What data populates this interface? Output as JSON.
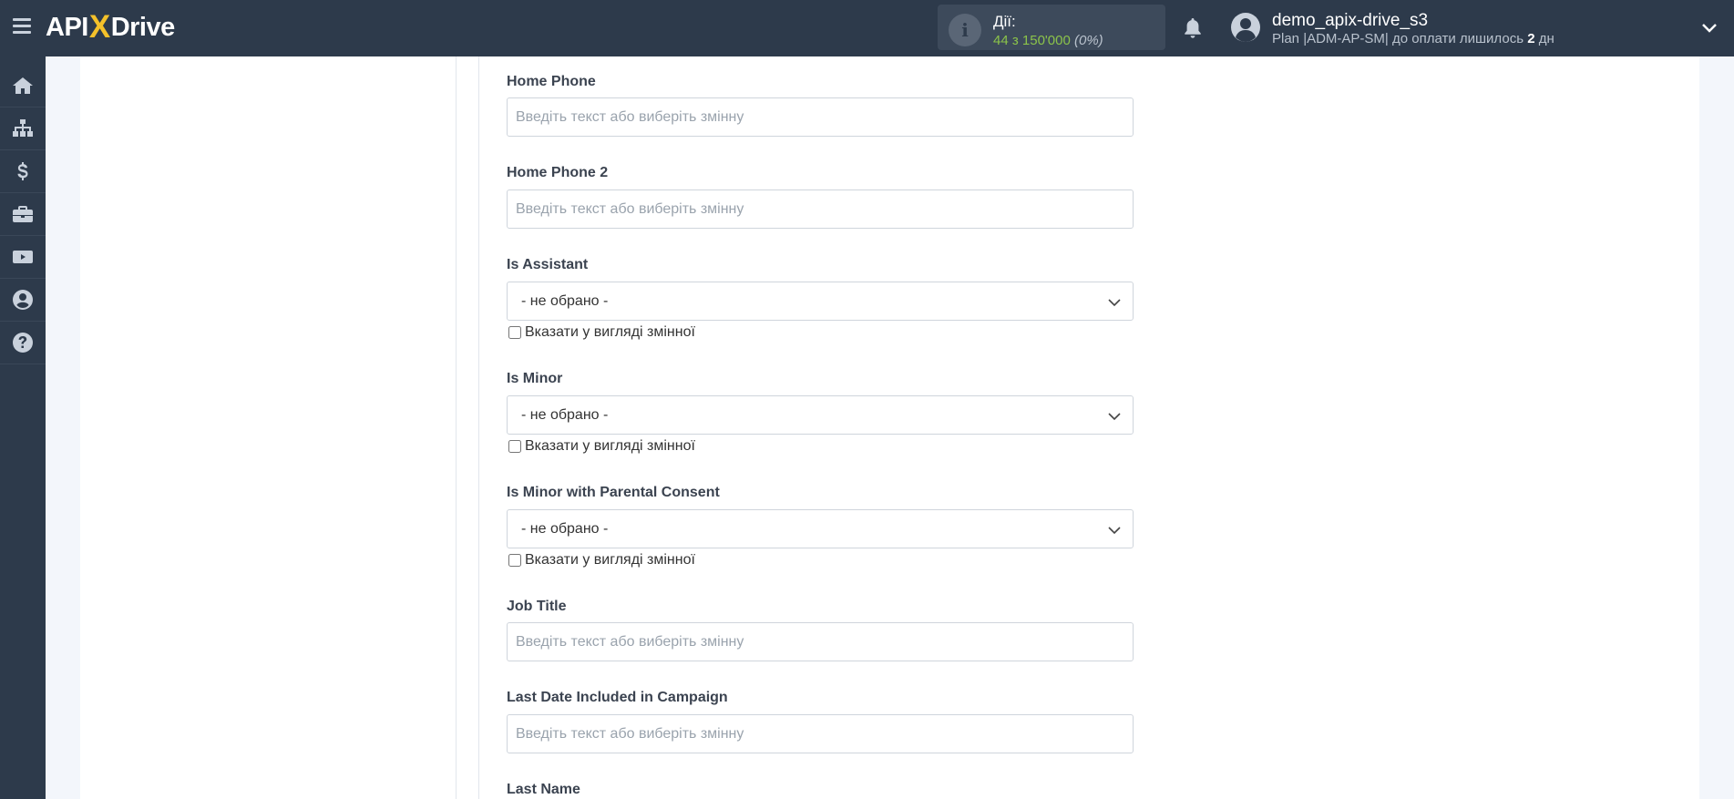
{
  "header": {
    "logo_left": "API",
    "logo_x": "X",
    "logo_right": "Drive",
    "actions_label": "Дії:",
    "actions_count": "44 з 150'000",
    "actions_percent": "(0%)",
    "user_name": "demo_apix-drive_s3",
    "user_plan_prefix": "Plan |ADM-AP-SM| до оплати лишилось",
    "user_plan_days": "2",
    "user_plan_suffix": "дн"
  },
  "sidebar": {
    "items": [
      {
        "icon": "home-icon"
      },
      {
        "icon": "sitemap-icon"
      },
      {
        "icon": "dollar-icon"
      },
      {
        "icon": "briefcase-icon"
      },
      {
        "icon": "youtube-icon"
      },
      {
        "icon": "user-circle-icon"
      },
      {
        "icon": "help-icon"
      }
    ]
  },
  "form": {
    "home_phone": {
      "label": "Home Phone",
      "placeholder": "Введіть текст або виберіть змінну",
      "value": ""
    },
    "home_phone_2": {
      "label": "Home Phone 2",
      "placeholder": "Введіть текст або виберіть змінну",
      "value": ""
    },
    "is_assistant": {
      "label": "Is Assistant",
      "selected": "- не обрано -",
      "checkbox_label": "Вказати у вигляді змінної"
    },
    "is_minor": {
      "label": "Is Minor",
      "selected": "- не обрано -",
      "checkbox_label": "Вказати у вигляді змінної"
    },
    "is_minor_parental": {
      "label": "Is Minor with Parental Consent",
      "selected": "- не обрано -",
      "checkbox_label": "Вказати у вигляді змінної"
    },
    "job_title": {
      "label": "Job Title",
      "placeholder": "Введіть текст або виберіть змінну",
      "value": ""
    },
    "last_date_campaign": {
      "label": "Last Date Included in Campaign",
      "placeholder": "Введіть текст або виберіть змінну",
      "value": ""
    },
    "last_name": {
      "label": "Last Name"
    }
  },
  "colors": {
    "topbar": "#2d3a4b",
    "accent_yellow": "#f4c12a",
    "count_green": "#8bc34a"
  }
}
